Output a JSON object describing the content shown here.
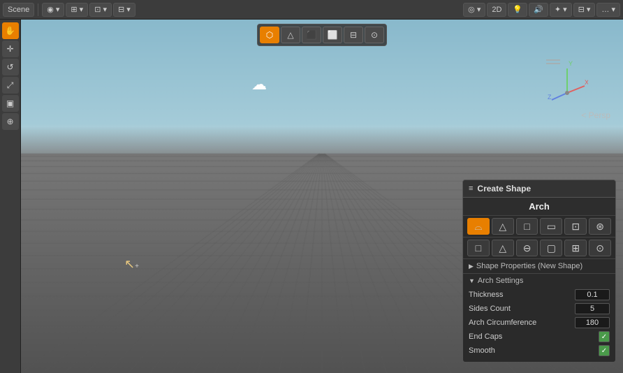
{
  "window": {
    "title": "Scene"
  },
  "top_toolbar": {
    "items": [
      {
        "id": "scene-label",
        "label": "# Scene",
        "interactable": true
      },
      {
        "id": "view-toggle",
        "label": "◉▾",
        "interactable": true
      },
      {
        "id": "grid-toggle",
        "label": "⊞▾",
        "interactable": true
      },
      {
        "id": "transform-toggle",
        "label": "⊡▾",
        "interactable": true
      },
      {
        "id": "snap-toggle",
        "label": "⊟▾",
        "interactable": true
      }
    ],
    "right_items": [
      {
        "id": "display-mode",
        "label": "◎▾",
        "interactable": true
      },
      {
        "id": "2d-btn",
        "label": "2D",
        "interactable": true
      },
      {
        "id": "light-btn",
        "label": "💡",
        "interactable": true
      },
      {
        "id": "audio-btn",
        "label": "🔊",
        "interactable": true
      },
      {
        "id": "fx-btn",
        "label": "✦▾",
        "interactable": true
      },
      {
        "id": "layers-btn",
        "label": "⊟▾",
        "interactable": true
      },
      {
        "id": "more-btn",
        "label": "…▾",
        "interactable": true
      }
    ]
  },
  "left_panel": {
    "buttons": [
      {
        "id": "hand-tool",
        "icon": "✋",
        "active": true
      },
      {
        "id": "move-tool",
        "icon": "✛",
        "active": false
      },
      {
        "id": "rotate-tool",
        "icon": "↺",
        "active": false
      },
      {
        "id": "scale-tool",
        "icon": "⤢",
        "active": false
      },
      {
        "id": "rect-tool",
        "icon": "▣",
        "active": false
      },
      {
        "id": "custom-tool",
        "icon": "⊕",
        "active": false
      }
    ]
  },
  "scene_top_bar": {
    "buttons": [
      {
        "id": "3d-toggle",
        "icon": "⬡",
        "active": true
      },
      {
        "id": "2d-toggle",
        "icon": "△",
        "active": false
      },
      {
        "id": "cube-solid",
        "icon": "⬛",
        "active": false
      },
      {
        "id": "cube-wire",
        "icon": "⬜",
        "active": false
      },
      {
        "id": "cube-parts",
        "icon": "⊟",
        "active": false
      },
      {
        "id": "sphere",
        "icon": "⊙",
        "active": false
      }
    ]
  },
  "persp_label": "< Persp",
  "create_shape_panel": {
    "header_icon": "≡",
    "title": "Create Shape",
    "arch_title": "Arch",
    "shape_row1": [
      {
        "id": "arch-btn",
        "icon": "⌓",
        "active": true
      },
      {
        "id": "triangle-btn",
        "icon": "△",
        "active": false
      },
      {
        "id": "rect-btn",
        "icon": "□",
        "active": false
      },
      {
        "id": "rect2-btn",
        "icon": "▭",
        "active": false
      },
      {
        "id": "cut-btn",
        "icon": "⊡",
        "active": false
      },
      {
        "id": "round-btn",
        "icon": "⊛",
        "active": false
      }
    ],
    "shape_row2": [
      {
        "id": "flat-btn",
        "icon": "□",
        "active": false
      },
      {
        "id": "tri2-btn",
        "icon": "△",
        "active": false
      },
      {
        "id": "circ-btn",
        "icon": "⊖",
        "active": false
      },
      {
        "id": "rect3-btn",
        "icon": "▢",
        "active": false
      },
      {
        "id": "arr-btn",
        "icon": "⊞",
        "active": false
      },
      {
        "id": "oval-btn",
        "icon": "⊙",
        "active": false
      }
    ],
    "shape_properties": {
      "label": "Shape Properties (New Shape)",
      "arrow": "▶"
    },
    "arch_settings": {
      "title": "Arch Settings",
      "arrow": "▼",
      "fields": [
        {
          "id": "thickness",
          "label": "Thickness",
          "value": "0.1",
          "type": "input"
        },
        {
          "id": "sides-count",
          "label": "Sides Count",
          "value": "5",
          "type": "input"
        },
        {
          "id": "arch-circumference",
          "label": "Arch Circumference",
          "value": "180",
          "type": "input"
        },
        {
          "id": "end-caps",
          "label": "End Caps",
          "value": "✓",
          "type": "checkbox"
        },
        {
          "id": "smooth",
          "label": "Smooth",
          "value": "✓",
          "type": "checkbox"
        }
      ]
    }
  }
}
